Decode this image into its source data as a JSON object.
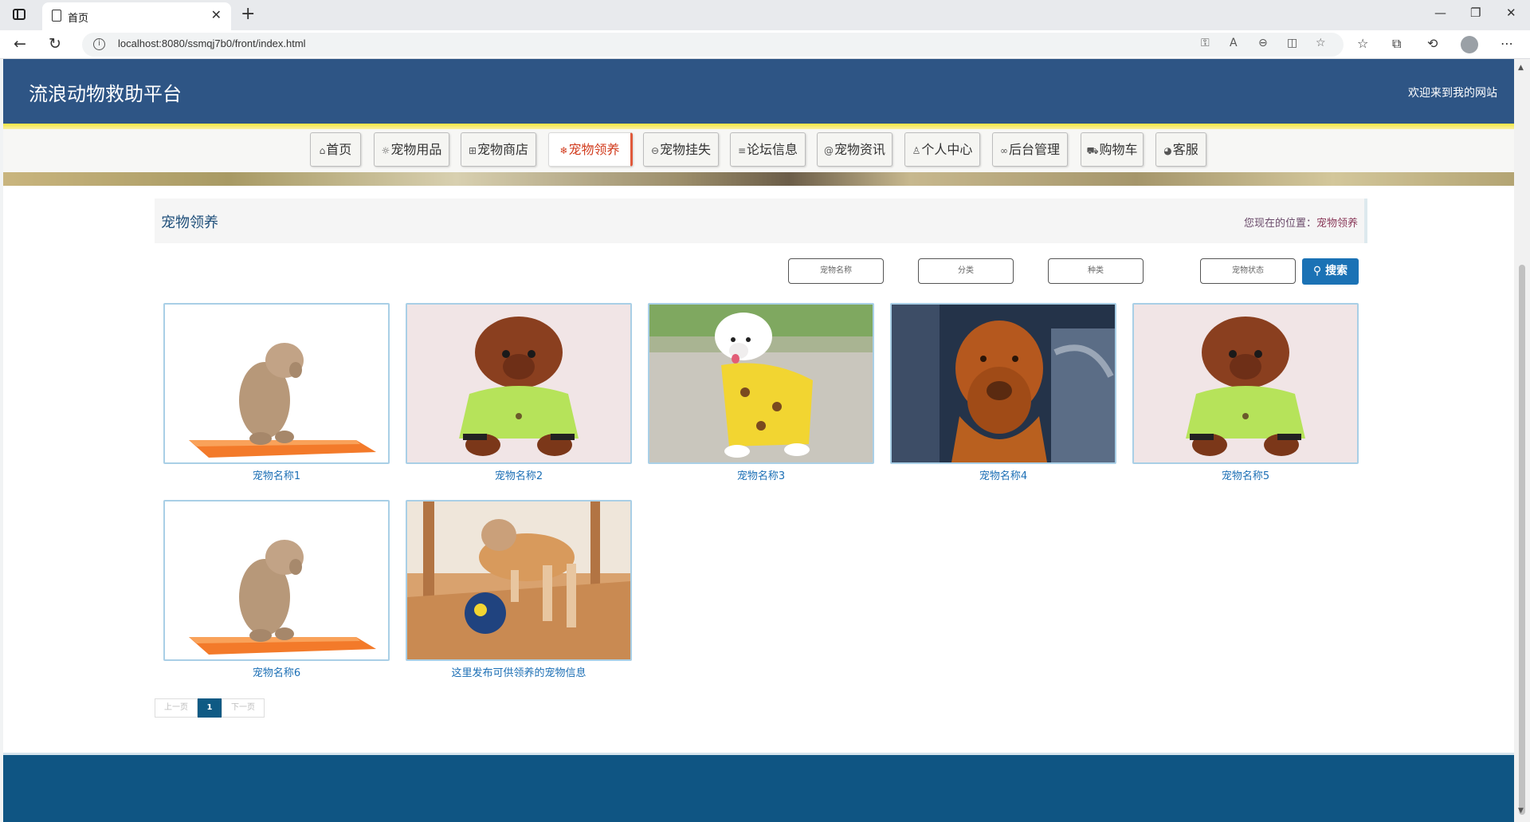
{
  "browser": {
    "tab_title": "首页",
    "url": "localhost:8080/ssmqj7b0/front/index.html"
  },
  "header": {
    "site_title": "流浪动物救助平台",
    "welcome": "欢迎来到我的网站"
  },
  "nav": {
    "items": [
      {
        "icon": "home-icon",
        "glyph": "⌂",
        "label": "首页",
        "active": false
      },
      {
        "icon": "gear-icon",
        "glyph": "☼",
        "label": "宠物用品",
        "active": false
      },
      {
        "icon": "shop-icon",
        "glyph": "⊞",
        "label": "宠物商店",
        "active": false
      },
      {
        "icon": "snowflake-icon",
        "glyph": "❄",
        "label": "宠物领养",
        "active": true
      },
      {
        "icon": "lost-icon",
        "glyph": "⊖",
        "label": "宠物挂失",
        "active": false
      },
      {
        "icon": "list-icon",
        "glyph": "≡",
        "label": "论坛信息",
        "active": false
      },
      {
        "icon": "at-icon",
        "glyph": "@",
        "label": "宠物资讯",
        "active": false
      },
      {
        "icon": "user-icon",
        "glyph": "♙",
        "label": "个人中心",
        "active": false
      },
      {
        "icon": "link-icon",
        "glyph": "∞",
        "label": "后台管理",
        "active": false
      },
      {
        "icon": "cart-icon",
        "glyph": "⛟",
        "label": "购物车",
        "active": false
      },
      {
        "icon": "chat-icon",
        "glyph": "◕",
        "label": "客服",
        "active": false
      }
    ]
  },
  "section": {
    "title": "宠物领养",
    "breadcrumb_prefix": "您现在的位置：",
    "breadcrumb_current": "宠物领养"
  },
  "filters": {
    "name_placeholder": "宠物名称",
    "category_placeholder": "分类",
    "species_placeholder": "种类",
    "status_placeholder": "宠物状态",
    "search_label": "搜索"
  },
  "pets": [
    {
      "name": "宠物名称1",
      "photo": "poodle-on-orange-mat"
    },
    {
      "name": "宠物名称2",
      "photo": "brown-poodle-green-shirt"
    },
    {
      "name": "宠物名称3",
      "photo": "white-dog-yellow-shirt"
    },
    {
      "name": "宠物名称4",
      "photo": "dogue-de-bordeaux"
    },
    {
      "name": "宠物名称5",
      "photo": "brown-poodle-green-shirt"
    },
    {
      "name": "宠物名称6",
      "photo": "poodle-on-orange-mat"
    },
    {
      "name": "这里发布可供领养的宠物信息",
      "photo": "dog-with-ball"
    }
  ],
  "pagination": {
    "prev": "上一页",
    "current": "1",
    "next": "下一页"
  },
  "colors": {
    "header": "#2e5585",
    "accent": "#1b72b5",
    "active_nav": "#d13b1d",
    "footer": "#0f5583"
  }
}
